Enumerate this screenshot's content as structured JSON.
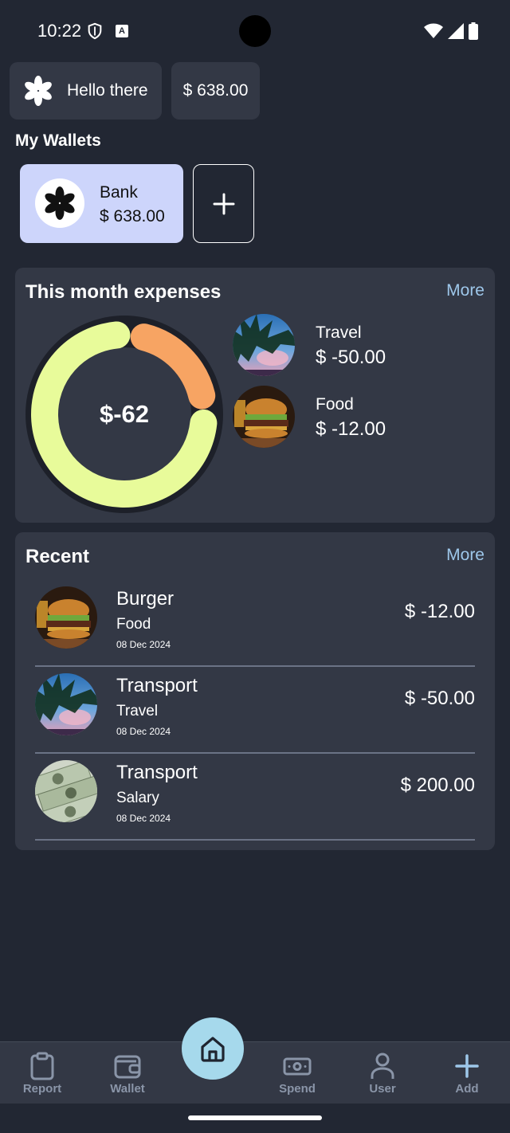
{
  "status_bar": {
    "time": "10:22"
  },
  "header": {
    "greeting": "Hello there",
    "balance": "$ 638.00"
  },
  "wallets": {
    "section_title": "My Wallets",
    "items": [
      {
        "name": "Bank",
        "amount": "$ 638.00"
      }
    ]
  },
  "expenses": {
    "title": "This month expenses",
    "more_label": "More",
    "total": "$-62",
    "chart_colors": {
      "travel": "#e8fb9a",
      "food": "#f7a463",
      "track": "#1d2029"
    },
    "items": [
      {
        "name": "Travel",
        "amount": "$ -50.00",
        "share": 0.806
      },
      {
        "name": "Food",
        "amount": "$ -12.00",
        "share": 0.194
      }
    ]
  },
  "recent": {
    "title": "Recent",
    "more_label": "More",
    "transactions": [
      {
        "title": "Burger",
        "category": "Food",
        "date": "08 Dec 2024",
        "amount": "$ -12.00"
      },
      {
        "title": "Transport",
        "category": "Travel",
        "date": "08 Dec 2024",
        "amount": "$ -50.00"
      },
      {
        "title": "Transport",
        "category": "Salary",
        "date": "08 Dec 2024",
        "amount": "$ 200.00"
      }
    ]
  },
  "nav": {
    "items": [
      {
        "label": "Report",
        "icon": "clipboard-icon"
      },
      {
        "label": "Wallet",
        "icon": "wallet-icon"
      },
      {
        "label": "Spend",
        "icon": "banknote-icon"
      },
      {
        "label": "User",
        "icon": "user-icon"
      },
      {
        "label": "Add",
        "icon": "plus-icon"
      }
    ],
    "home_icon": "home-icon",
    "colors": {
      "home_bg": "#a6d9ec",
      "label": "#8a95a8",
      "add": "#9ec7ea"
    }
  }
}
